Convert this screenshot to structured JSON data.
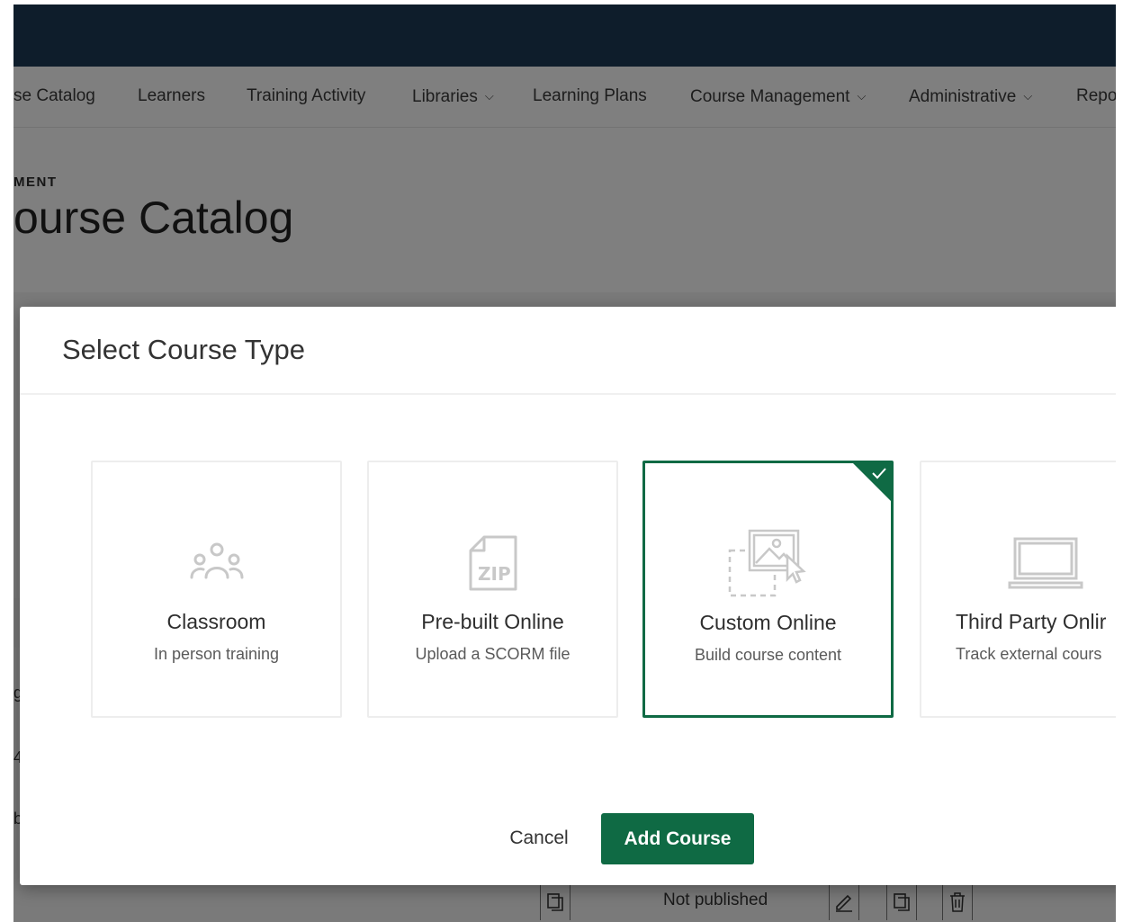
{
  "nav": {
    "items": [
      {
        "label": "se Catalog"
      },
      {
        "label": "Learners"
      },
      {
        "label": "Training Activity"
      },
      {
        "label": "Libraries",
        "has_dropdown": true
      },
      {
        "label": "Learning Plans"
      },
      {
        "label": "Course Management",
        "has_dropdown": true
      },
      {
        "label": "Administrative",
        "has_dropdown": true
      },
      {
        "label": "Repo"
      }
    ],
    "chevron": "⌵"
  },
  "page": {
    "eyebrow": "MENT",
    "title": "ourse Catalog"
  },
  "background_table": {
    "status_text": "Not published",
    "left_chars": [
      "g",
      "4",
      "b"
    ],
    "icons": [
      "copy-icon",
      "edit-icon",
      "copy-icon",
      "trash-icon"
    ]
  },
  "modal": {
    "title": "Select Course Type",
    "cards": [
      {
        "id": "classroom",
        "title": "Classroom",
        "subtitle": "In person training",
        "icon": "people-icon",
        "selected": false
      },
      {
        "id": "prebuilt",
        "title": "Pre-built Online",
        "subtitle": "Upload a SCORM file",
        "icon": "zip-file-icon",
        "selected": false
      },
      {
        "id": "custom",
        "title": "Custom Online",
        "subtitle": "Build course content",
        "icon": "image-cursor-icon",
        "selected": true
      },
      {
        "id": "thirdparty",
        "title": "Third Party Onlir",
        "subtitle": "Track external cours",
        "icon": "laptop-icon",
        "selected": false
      }
    ],
    "cancel_label": "Cancel",
    "add_label": "Add Course"
  },
  "colors": {
    "topbar": "#1d3a57",
    "accent": "#0f6a44",
    "icon_gray": "#c8c8c8"
  }
}
